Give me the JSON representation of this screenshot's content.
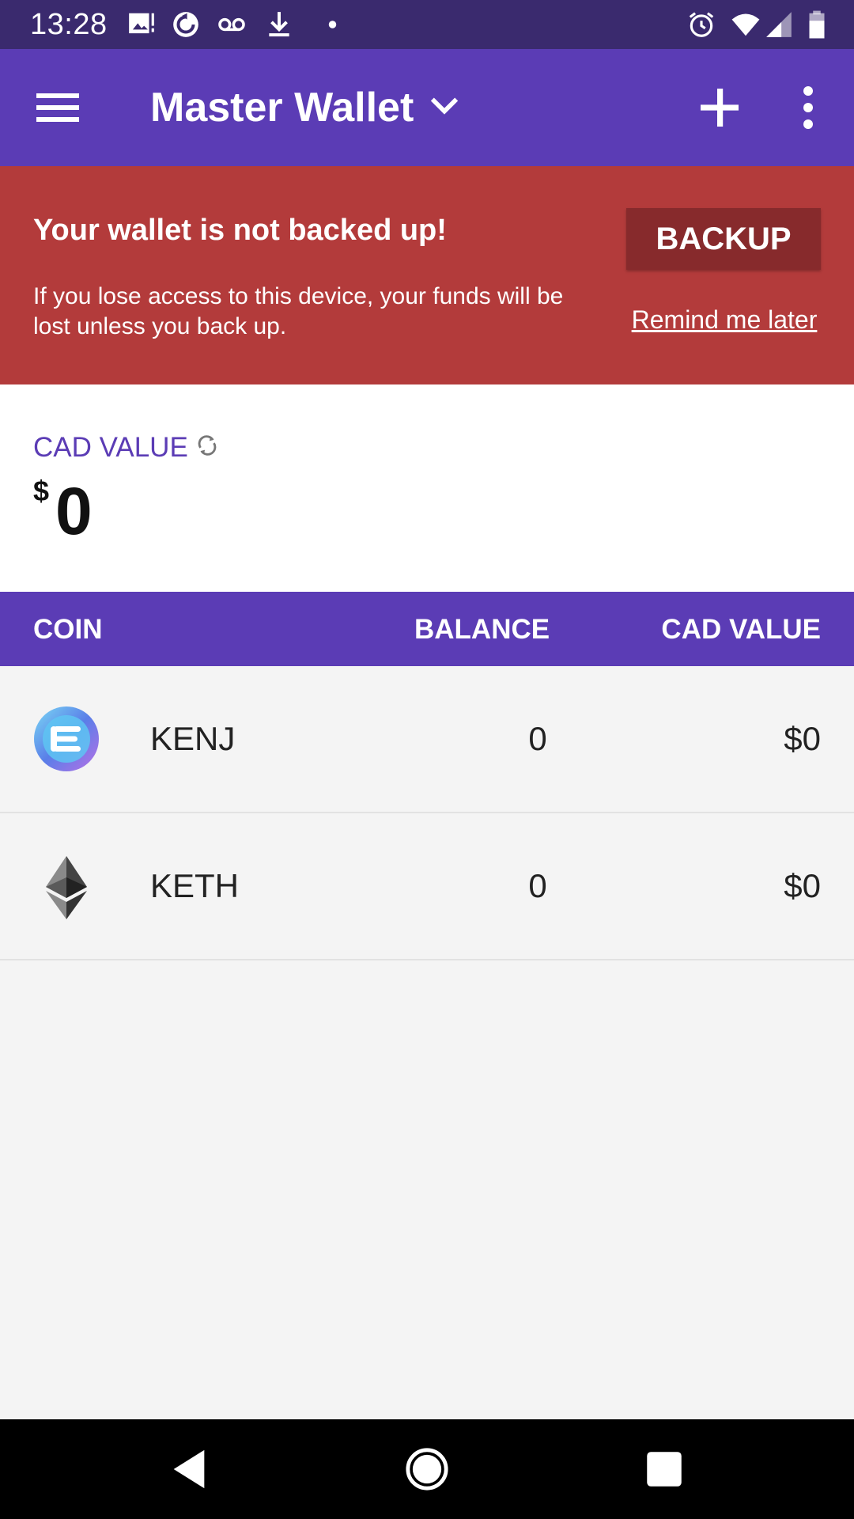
{
  "status_bar": {
    "time": "13:28",
    "left_icons": [
      "image-alert-icon",
      "sync-icon",
      "voicemail-icon",
      "download-icon",
      "dot-icon"
    ],
    "right_icons": [
      "alarm-icon",
      "wifi-icon",
      "signal-icon",
      "battery-icon"
    ]
  },
  "app_bar": {
    "title": "Master Wallet",
    "icons": [
      "menu-icon",
      "chevron-down-icon",
      "add-icon",
      "more-vert-icon"
    ]
  },
  "backup_banner": {
    "title": "Your wallet is not backed up!",
    "message": "If you lose access to this device, your funds will be lost unless you back up.",
    "backup_label": "BACKUP",
    "remind_label": "Remind me later",
    "bg_color": "#b33b3b"
  },
  "total": {
    "label": "CAD VALUE",
    "currency_symbol": "$",
    "amount": "0"
  },
  "table": {
    "headers": {
      "coin": "COIN",
      "balance": "BALANCE",
      "value": "CAD VALUE"
    },
    "rows": [
      {
        "icon": "enjin-coin-icon",
        "coin": "KENJ",
        "balance": "0",
        "value": "$0"
      },
      {
        "icon": "ethereum-icon",
        "coin": "KETH",
        "balance": "0",
        "value": "$0"
      }
    ]
  },
  "nav_bar": {
    "icons": [
      "back-icon",
      "home-icon",
      "recents-icon"
    ]
  },
  "colors": {
    "primary": "#5b3cb5",
    "status_bar": "#3a2a6e",
    "danger": "#b33b3b"
  }
}
